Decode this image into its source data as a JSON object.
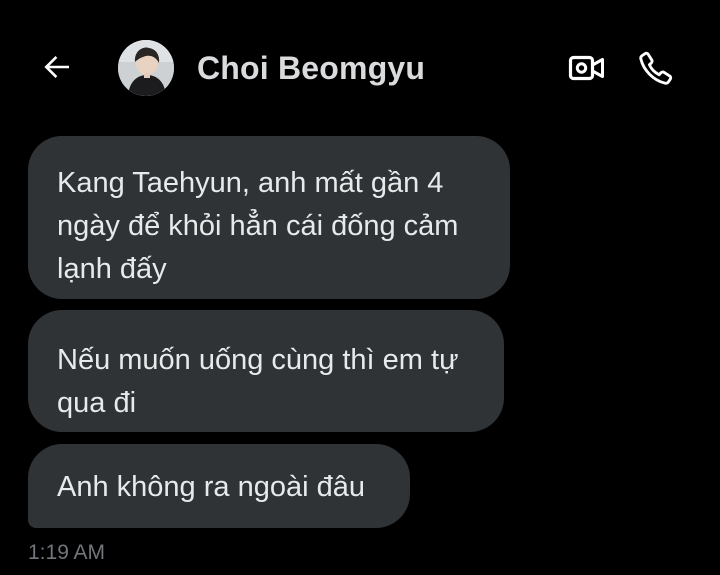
{
  "header": {
    "back_icon": "arrow-left-icon",
    "contact_name": "Choi Beomgyu",
    "video_icon": "video-camera-icon",
    "call_icon": "phone-icon"
  },
  "messages": [
    {
      "lines": [
        "Kang Taehyun, anh mất gần 4",
        "ngày để khỏi hẳn cái đống cảm",
        "lạnh đấy"
      ]
    },
    {
      "lines": [
        "Nếu muốn uống cùng thì em tự",
        "qua đi"
      ]
    },
    {
      "lines": [
        "Anh không ra ngoài đâu"
      ]
    }
  ],
  "timestamp": "1:19 AM",
  "colors": {
    "background": "#000000",
    "bubble": "#2f3336",
    "text": "#e7e9ea",
    "muted": "#71767b"
  }
}
